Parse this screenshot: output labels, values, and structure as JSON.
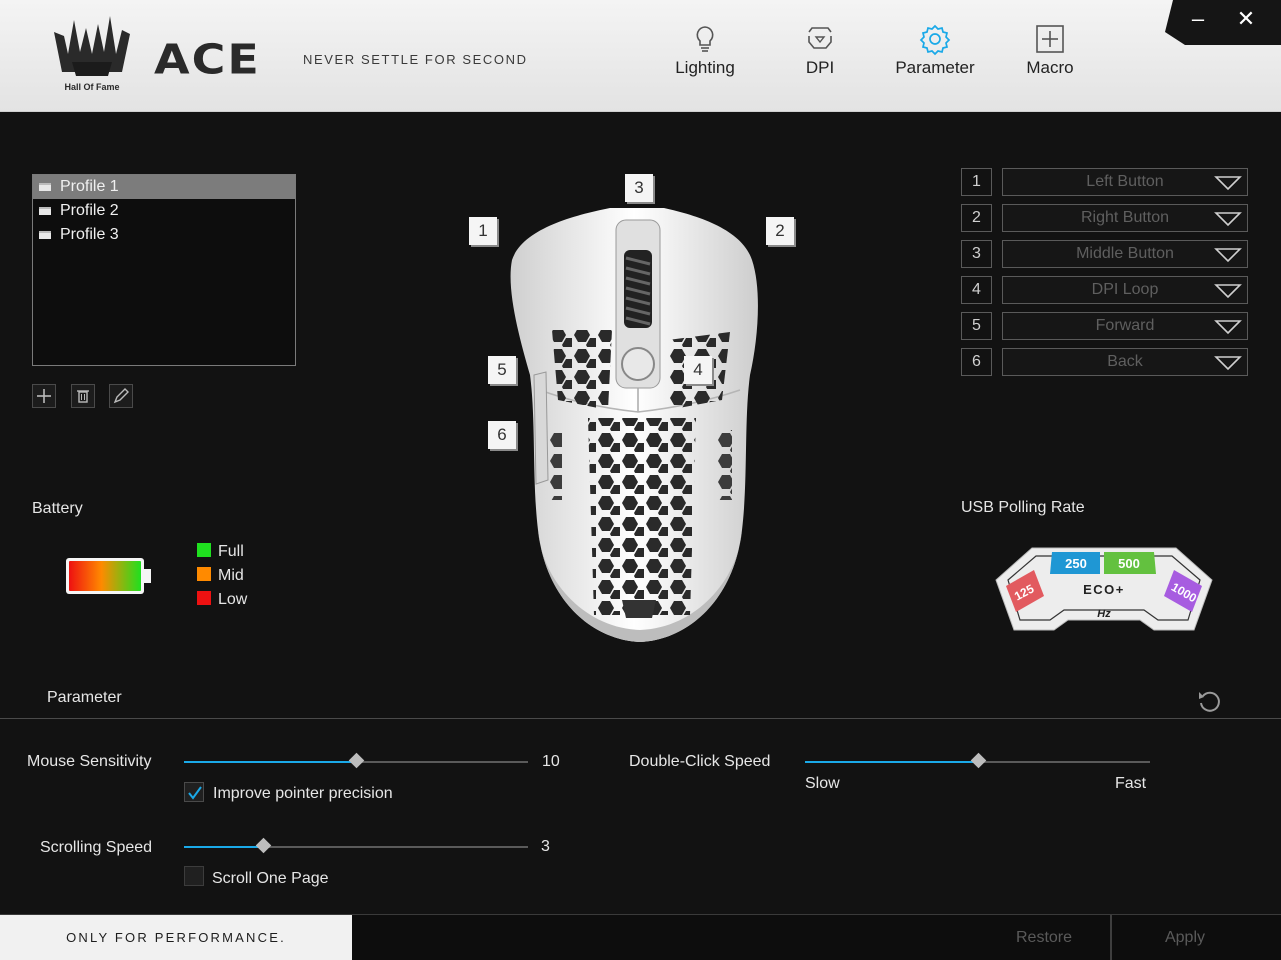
{
  "header": {
    "logo_text": "Hall Of Fame",
    "brand": "ACE",
    "slogan": "NEVER SETTLE FOR SECOND",
    "tabs": [
      {
        "label": "Lighting",
        "icon": "bulb-icon",
        "active": false
      },
      {
        "label": "DPI",
        "icon": "dpi-icon",
        "active": false
      },
      {
        "label": "Parameter",
        "icon": "gear-icon",
        "active": true
      },
      {
        "label": "Macro",
        "icon": "macro-plus-icon",
        "active": false
      }
    ],
    "minimize": "–",
    "close": "✕"
  },
  "profiles": {
    "items": [
      "Profile 1",
      "Profile 2",
      "Profile 3"
    ],
    "selected_index": 0
  },
  "battery": {
    "title": "Battery",
    "legend": [
      {
        "label": "Full",
        "color": "#1fe01f"
      },
      {
        "label": "Mid",
        "color": "#ff8a00"
      },
      {
        "label": "Low",
        "color": "#ee1111"
      }
    ]
  },
  "mouse": {
    "markers": [
      "1",
      "2",
      "3",
      "4",
      "5",
      "6"
    ]
  },
  "button_assignments": [
    {
      "number": "1",
      "action": "Left Button"
    },
    {
      "number": "2",
      "action": "Right Button"
    },
    {
      "number": "3",
      "action": "Middle Button"
    },
    {
      "number": "4",
      "action": "DPI Loop"
    },
    {
      "number": "5",
      "action": "Forward"
    },
    {
      "number": "6",
      "action": "Back"
    }
  ],
  "polling": {
    "title": "USB Polling Rate",
    "rates": [
      "125",
      "250",
      "500",
      "1000"
    ],
    "colors": {
      "125": "#e25a5f",
      "250": "#1f97d4",
      "500": "#63c13f",
      "1000": "#a75ce0"
    },
    "mode": "ECO+",
    "unit": "Hz"
  },
  "parameter": {
    "title": "Parameter",
    "mouse_sensitivity": {
      "label": "Mouse Sensitivity",
      "value": "10",
      "fraction": 0.5
    },
    "improve_precision": {
      "label": "Improve pointer precision",
      "checked": true
    },
    "scrolling_speed": {
      "label": "Scrolling Speed",
      "value": "3",
      "fraction": 0.23
    },
    "scroll_one_page": {
      "label": "Scroll One Page",
      "checked": false
    },
    "double_click_speed": {
      "label": "Double-Click Speed",
      "min_label": "Slow",
      "max_label": "Fast",
      "fraction": 0.5
    }
  },
  "footer": {
    "slogan": "ONLY FOR PERFORMANCE.",
    "restore": "Restore",
    "apply": "Apply"
  },
  "accent_color": "#1aa9e8"
}
